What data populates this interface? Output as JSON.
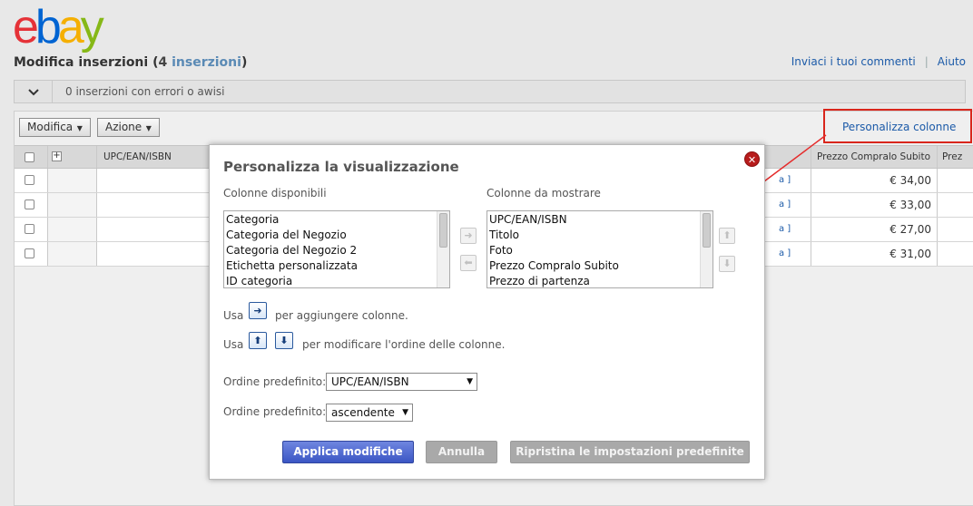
{
  "logo": {
    "e": "e",
    "b": "b",
    "a": "a",
    "y": "y"
  },
  "page": {
    "title_prefix": "Modifica inserzioni (",
    "count": "4",
    "count_label": "inserzioni",
    "title_suffix": ")"
  },
  "top_links": {
    "feedback": "Inviaci i tuoi commenti",
    "separator": "|",
    "help": "Aiuto"
  },
  "errors_bar": {
    "text": "0 inserzioni con errori o awisi"
  },
  "toolbar": {
    "edit_label": "Modifica",
    "action_label": "Azione",
    "customize_label": "Personalizza colonne"
  },
  "table": {
    "headers": {
      "upc": "UPC/EAN/ISBN",
      "buy_now": "Prezzo Compralo Subito",
      "next": "Prez"
    },
    "row_link_fragment": "a ]",
    "rows": [
      {
        "price": "€ 34,00"
      },
      {
        "price": "€ 33,00"
      },
      {
        "price": "€ 27,00"
      },
      {
        "price": "€ 31,00"
      }
    ]
  },
  "modal": {
    "title": "Personalizza la visualizzazione",
    "available_label": "Colonne disponibili",
    "available_items": [
      "Categoria",
      "Categoria del Negozio",
      "Categoria del Negozio 2",
      "Etichetta personalizzata",
      "ID categoria"
    ],
    "shown_label": "Colonne da mostrare",
    "shown_items": [
      "UPC/EAN/ISBN",
      "Titolo",
      "Foto",
      "Prezzo Compralo Subito",
      "Prezzo di partenza"
    ],
    "use_label": "Usa",
    "add_hint": "per aggiungere colonne.",
    "order_hint": "per modificare l'ordine delle colonne.",
    "sort1_label": "Ordine predefinito:",
    "sort1_value": "UPC/EAN/ISBN",
    "sort2_label": "Ordine predefinito:",
    "sort2_value": "ascendente",
    "apply": "Applica modifiche",
    "cancel": "Annulla",
    "reset": "Ripristina le impostazioni predefinite"
  },
  "colors": {
    "accent": "#3b56c4",
    "highlight": "#d9261c",
    "link": "#1b5aa8"
  }
}
